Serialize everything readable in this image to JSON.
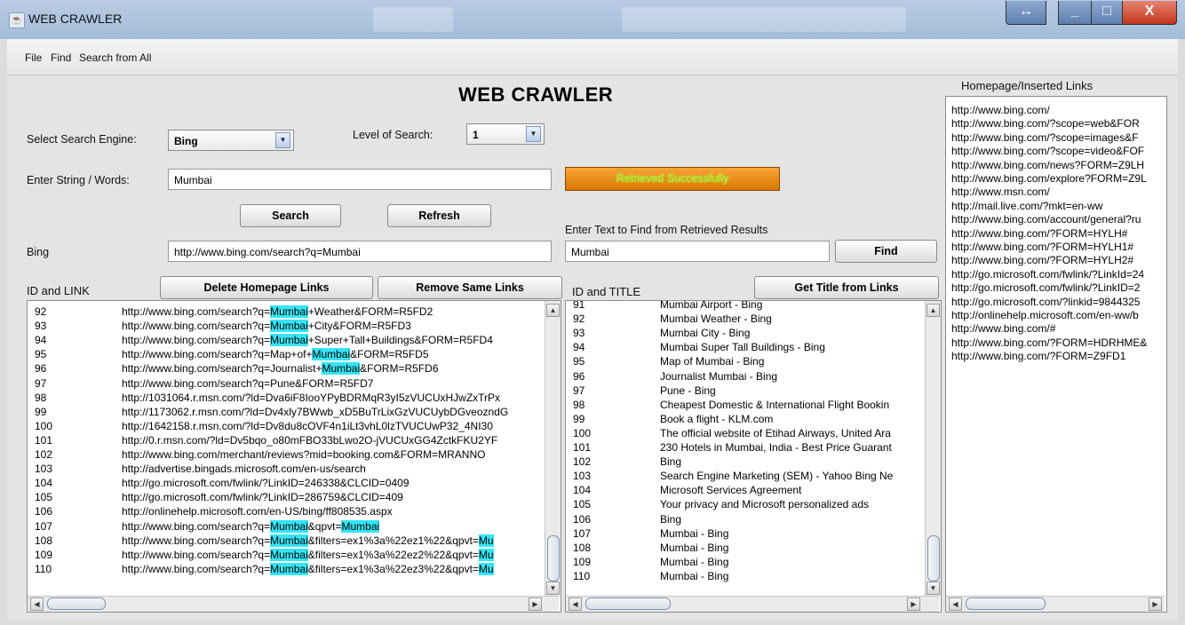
{
  "window": {
    "title": "WEB CRAWLER",
    "min": "_",
    "max": "□",
    "close": "X",
    "restore": "↔"
  },
  "menu": [
    "File",
    "Find",
    "Search from All"
  ],
  "header": "WEB CRAWLER",
  "engine": {
    "label": "Select Search Engine:",
    "value": "Bing"
  },
  "level": {
    "label": "Level of Search:",
    "value": "1"
  },
  "query": {
    "label": "Enter String / Words:",
    "value": "Mumbai"
  },
  "status": "Retrieved Successfully",
  "buttons": {
    "search": "Search",
    "refresh": "Refresh",
    "find": "Find",
    "delete_home": "Delete Homepage Links",
    "remove_same": "Remove Same Links",
    "get_title": "Get Title from Links"
  },
  "engine_url": {
    "label": "Bing",
    "value": "http://www.bing.com/search?q=Mumbai"
  },
  "find": {
    "label": "Enter Text to Find from Retrieved Results",
    "value": "Mumbai"
  },
  "links_panel": {
    "label": "ID and LINK"
  },
  "titles_panel": {
    "label": "ID and TITLE"
  },
  "homepage_panel": {
    "label": "Homepage/Inserted Links"
  },
  "links": [
    {
      "id": "92",
      "parts": [
        [
          "http://www.bing.com/search?q=",
          0
        ],
        [
          "Mumbai",
          1
        ],
        [
          "+Weather&FORM=R5FD2",
          0
        ]
      ]
    },
    {
      "id": "93",
      "parts": [
        [
          "http://www.bing.com/search?q=",
          0
        ],
        [
          "Mumbai",
          1
        ],
        [
          "+City&FORM=R5FD3",
          0
        ]
      ]
    },
    {
      "id": "94",
      "parts": [
        [
          "http://www.bing.com/search?q=",
          0
        ],
        [
          "Mumbai",
          1
        ],
        [
          "+Super+Tall+Buildings&FORM=R5FD4",
          0
        ]
      ]
    },
    {
      "id": "95",
      "parts": [
        [
          "http://www.bing.com/search?q=Map+of+",
          0
        ],
        [
          "Mumbai",
          1
        ],
        [
          "&FORM=R5FD5",
          0
        ]
      ]
    },
    {
      "id": "96",
      "parts": [
        [
          "http://www.bing.com/search?q=Journalist+",
          0
        ],
        [
          "Mumbai",
          1
        ],
        [
          "&FORM=R5FD6",
          0
        ]
      ]
    },
    {
      "id": "97",
      "parts": [
        [
          "http://www.bing.com/search?q=Pune&FORM=R5FD7",
          0
        ]
      ]
    },
    {
      "id": "98",
      "parts": [
        [
          "http://1031064.r.msn.com/?ld=Dva6iF8IooYPyBDRMqR3yI5zVUCUxHJwZxTrPx",
          0
        ]
      ]
    },
    {
      "id": "99",
      "parts": [
        [
          "http://1173062.r.msn.com/?ld=Dv4xly7BWwb_xD5BuTrLixGzVUCUybDGveozndG",
          0
        ]
      ]
    },
    {
      "id": "100",
      "parts": [
        [
          "http://1642158.r.msn.com/?ld=Dv8du8cOVF4n1iLt3vhL0lzTVUCUwP32_4NI30",
          0
        ]
      ]
    },
    {
      "id": "101",
      "parts": [
        [
          "http://0.r.msn.com/?ld=Dv5bqo_o80mFBO33bLwo2O-jVUCUxGG4ZctkFKU2YF",
          0
        ]
      ]
    },
    {
      "id": "102",
      "parts": [
        [
          "http://www.bing.com/merchant/reviews?mid=booking.com&FORM=MRANNO",
          0
        ]
      ]
    },
    {
      "id": "103",
      "parts": [
        [
          "http://advertise.bingads.microsoft.com/en-us/search",
          0
        ]
      ]
    },
    {
      "id": "104",
      "parts": [
        [
          "http://go.microsoft.com/fwlink/?LinkID=246338&CLCID=0409",
          0
        ]
      ]
    },
    {
      "id": "105",
      "parts": [
        [
          "http://go.microsoft.com/fwlink/?LinkID=286759&CLCID=409",
          0
        ]
      ]
    },
    {
      "id": "106",
      "parts": [
        [
          "http://onlinehelp.microsoft.com/en-US/bing/ff808535.aspx",
          0
        ]
      ]
    },
    {
      "id": "107",
      "parts": [
        [
          "http://www.bing.com/search?q=",
          0
        ],
        [
          "Mumbai",
          1
        ],
        [
          "&qpvt=",
          0
        ],
        [
          "Mumbai",
          1
        ]
      ]
    },
    {
      "id": "108",
      "parts": [
        [
          "http://www.bing.com/search?q=",
          0
        ],
        [
          "Mumbai",
          1
        ],
        [
          "&filters=ex1%3a%22ez1%22&qpvt=",
          0
        ],
        [
          "Mu",
          1
        ]
      ]
    },
    {
      "id": "109",
      "parts": [
        [
          "http://www.bing.com/search?q=",
          0
        ],
        [
          "Mumbai",
          1
        ],
        [
          "&filters=ex1%3a%22ez2%22&qpvt=",
          0
        ],
        [
          "Mu",
          1
        ]
      ]
    },
    {
      "id": "110",
      "parts": [
        [
          "http://www.bing.com/search?q=",
          0
        ],
        [
          "Mumbai",
          1
        ],
        [
          "&filters=ex1%3a%22ez3%22&qpvt=",
          0
        ],
        [
          "Mu",
          1
        ]
      ]
    }
  ],
  "titles": [
    {
      "id": "91",
      "t": "Mumbai Airport - Bing"
    },
    {
      "id": "92",
      "t": "Mumbai Weather - Bing"
    },
    {
      "id": "93",
      "t": "Mumbai City - Bing"
    },
    {
      "id": "94",
      "t": "Mumbai Super Tall Buildings - Bing"
    },
    {
      "id": "95",
      "t": "Map of Mumbai - Bing"
    },
    {
      "id": "96",
      "t": "Journalist Mumbai - Bing"
    },
    {
      "id": "97",
      "t": "Pune - Bing"
    },
    {
      "id": "98",
      "t": "Cheapest Domestic & International Flight Bookin"
    },
    {
      "id": "99",
      "t": "Book a flight - KLM.com"
    },
    {
      "id": "100",
      "t": "The official website of Etihad Airways, United Ara"
    },
    {
      "id": "101",
      "t": "230 Hotels in Mumbai, India - Best Price Guarant"
    },
    {
      "id": "102",
      "t": "Bing"
    },
    {
      "id": "103",
      "t": "Search Engine Marketing (SEM) - Yahoo Bing Ne"
    },
    {
      "id": "104",
      "t": "Microsoft Services Agreement"
    },
    {
      "id": "105",
      "t": "Your privacy and Microsoft personalized ads"
    },
    {
      "id": "106",
      "t": "Bing"
    },
    {
      "id": "107",
      "t": "Mumbai - Bing"
    },
    {
      "id": "108",
      "t": "Mumbai - Bing"
    },
    {
      "id": "109",
      "t": "Mumbai - Bing"
    },
    {
      "id": "110",
      "t": "Mumbai - Bing"
    }
  ],
  "homepage_links": [
    "http://www.bing.com/",
    "http://www.bing.com/?scope=web&FOR",
    "http://www.bing.com/?scope=images&F",
    "http://www.bing.com/?scope=video&FOF",
    "http://www.bing.com/news?FORM=Z9LH",
    "http://www.bing.com/explore?FORM=Z9L",
    "http://www.msn.com/",
    "http://mail.live.com/?mkt=en-ww",
    "http://www.bing.com/account/general?ru",
    "http://www.bing.com/?FORM=HYLH#",
    "http://www.bing.com/?FORM=HYLH1#",
    "http://www.bing.com/?FORM=HYLH2#",
    "http://go.microsoft.com/fwlink/?LinkId=24",
    "http://go.microsoft.com/fwlink/?LinkID=2",
    "http://go.microsoft.com/?linkid=9844325",
    "http://onlinehelp.microsoft.com/en-ww/b",
    "http://www.bing.com/#",
    "http://www.bing.com/?FORM=HDRHME&",
    "http://www.bing.com/?FORM=Z9FD1"
  ]
}
